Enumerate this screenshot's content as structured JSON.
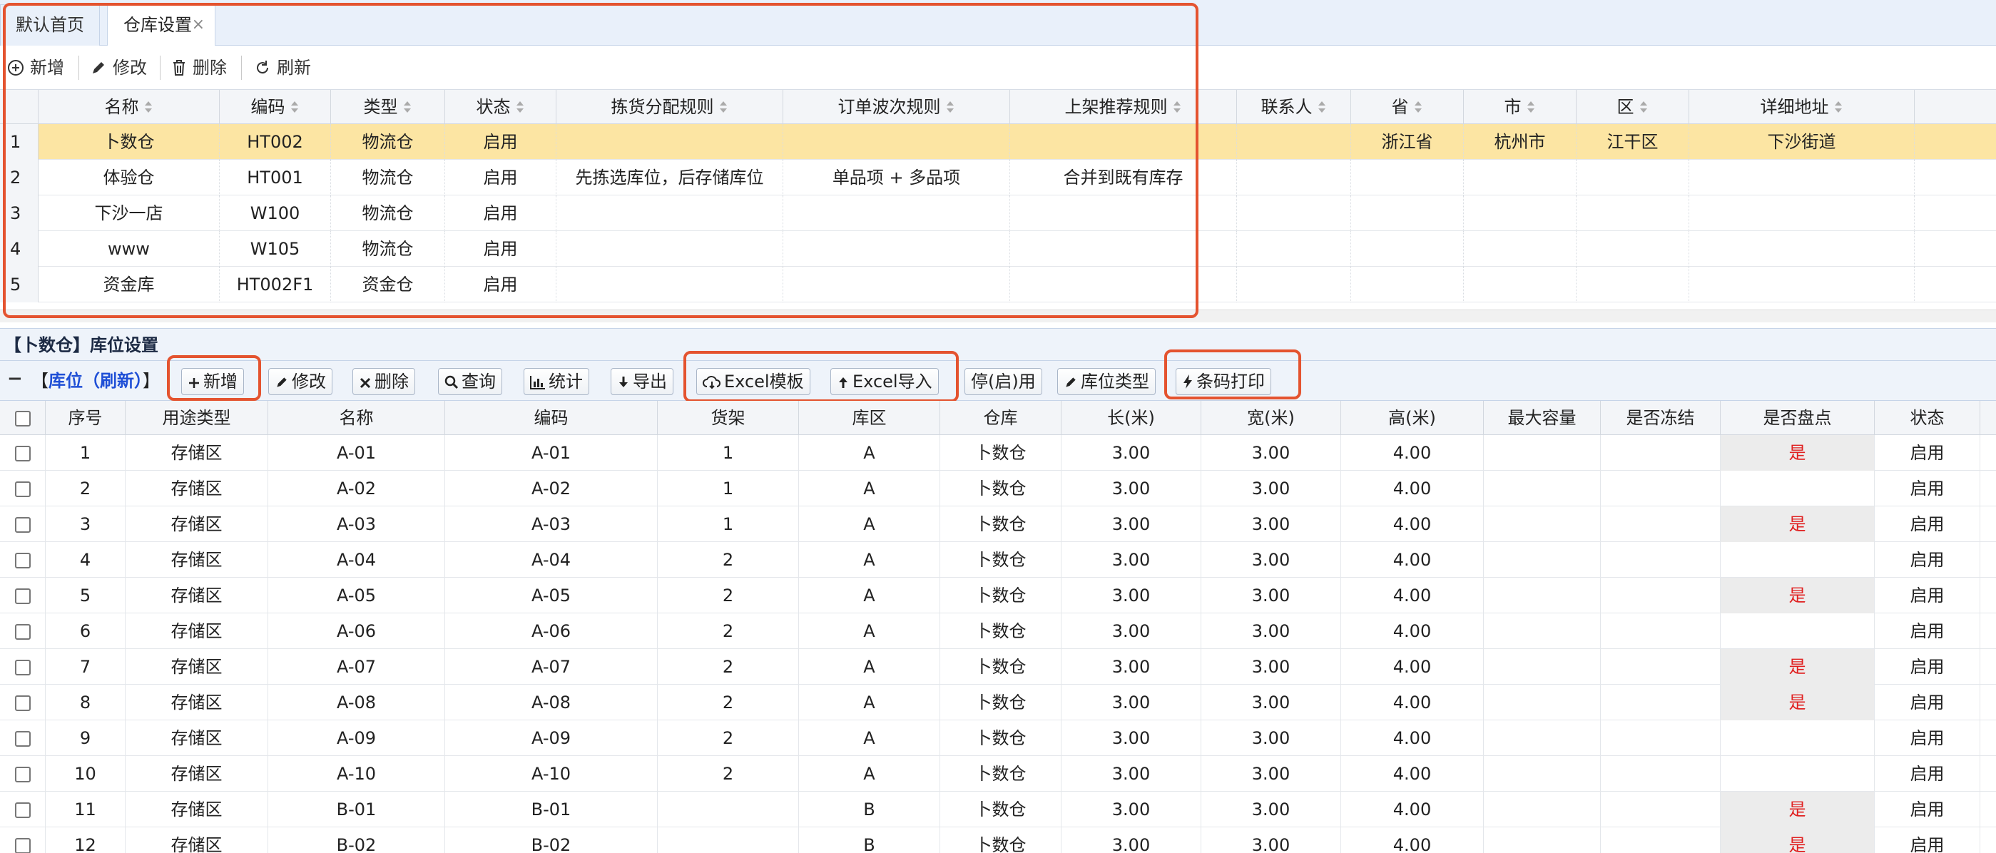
{
  "tabs": [
    {
      "label": "默认首页"
    },
    {
      "label": "仓库设置",
      "close": "×"
    }
  ],
  "toolbar_top": {
    "add": "新增",
    "edit": "修改",
    "delete": "删除",
    "refresh": "刷新"
  },
  "warehouse_grid": {
    "columns": [
      "名称",
      "编码",
      "类型",
      "状态",
      "拣货分配规则",
      "订单波次规则",
      "上架推荐规则",
      "联系人",
      "省",
      "市",
      "区",
      "详细地址"
    ],
    "rows": [
      {
        "num": "1",
        "name": "卜数仓",
        "code": "HT002",
        "type": "物流仓",
        "status": "启用",
        "pick_rule": "",
        "wave_rule": "",
        "putaway_rule": "",
        "contact": "",
        "province": "浙江省",
        "city": "杭州市",
        "district": "江干区",
        "address": "下沙街道",
        "selected": true
      },
      {
        "num": "2",
        "name": "体验仓",
        "code": "HT001",
        "type": "物流仓",
        "status": "启用",
        "pick_rule": "先拣选库位，后存储库位",
        "wave_rule": "单品项 + 多品项",
        "putaway_rule": "合并到既有库存",
        "contact": "",
        "province": "",
        "city": "",
        "district": "",
        "address": ""
      },
      {
        "num": "3",
        "name": "下沙一店",
        "code": "W100",
        "type": "物流仓",
        "status": "启用",
        "pick_rule": "",
        "wave_rule": "",
        "putaway_rule": "",
        "contact": "",
        "province": "",
        "city": "",
        "district": "",
        "address": ""
      },
      {
        "num": "4",
        "name": "www",
        "code": "W105",
        "type": "物流仓",
        "status": "启用",
        "pick_rule": "",
        "wave_rule": "",
        "putaway_rule": "",
        "contact": "",
        "province": "",
        "city": "",
        "district": "",
        "address": ""
      },
      {
        "num": "5",
        "name": "资金库",
        "code": "HT002F1",
        "type": "资金仓",
        "status": "启用",
        "pick_rule": "",
        "wave_rule": "",
        "putaway_rule": "",
        "contact": "",
        "province": "",
        "city": "",
        "district": "",
        "address": ""
      }
    ]
  },
  "location_panel": {
    "title": "【卜数仓】库位设置",
    "collapse": "−",
    "ref_prefix": "【",
    "ref_link": "库位（刷新）",
    "ref_suffix": "】",
    "buttons": {
      "add": "新增",
      "edit": "修改",
      "delete": "删除",
      "query": "查询",
      "stats": "统计",
      "export": "导出",
      "excel_template": "Excel模板",
      "excel_import": "Excel导入",
      "toggle": "停(启)用",
      "location_type": "库位类型",
      "barcode_print": "条码打印"
    }
  },
  "location_grid": {
    "columns": [
      "序号",
      "用途类型",
      "名称",
      "编码",
      "货架",
      "库区",
      "仓库",
      "长(米)",
      "宽(米)",
      "高(米)",
      "最大容量",
      "是否冻结",
      "是否盘点",
      "状态"
    ],
    "rows": [
      {
        "seq": "1",
        "usage": "存储区",
        "name": "A-01",
        "code": "A-01",
        "shelf": "1",
        "zone": "A",
        "warehouse": "卜数仓",
        "length": "3.00",
        "width": "3.00",
        "height": "4.00",
        "capacity": "",
        "frozen": "",
        "counted": "是",
        "status": "启用"
      },
      {
        "seq": "2",
        "usage": "存储区",
        "name": "A-02",
        "code": "A-02",
        "shelf": "1",
        "zone": "A",
        "warehouse": "卜数仓",
        "length": "3.00",
        "width": "3.00",
        "height": "4.00",
        "capacity": "",
        "frozen": "",
        "counted": "",
        "status": "启用"
      },
      {
        "seq": "3",
        "usage": "存储区",
        "name": "A-03",
        "code": "A-03",
        "shelf": "1",
        "zone": "A",
        "warehouse": "卜数仓",
        "length": "3.00",
        "width": "3.00",
        "height": "4.00",
        "capacity": "",
        "frozen": "",
        "counted": "是",
        "status": "启用"
      },
      {
        "seq": "4",
        "usage": "存储区",
        "name": "A-04",
        "code": "A-04",
        "shelf": "2",
        "zone": "A",
        "warehouse": "卜数仓",
        "length": "3.00",
        "width": "3.00",
        "height": "4.00",
        "capacity": "",
        "frozen": "",
        "counted": "",
        "status": "启用"
      },
      {
        "seq": "5",
        "usage": "存储区",
        "name": "A-05",
        "code": "A-05",
        "shelf": "2",
        "zone": "A",
        "warehouse": "卜数仓",
        "length": "3.00",
        "width": "3.00",
        "height": "4.00",
        "capacity": "",
        "frozen": "",
        "counted": "是",
        "status": "启用"
      },
      {
        "seq": "6",
        "usage": "存储区",
        "name": "A-06",
        "code": "A-06",
        "shelf": "2",
        "zone": "A",
        "warehouse": "卜数仓",
        "length": "3.00",
        "width": "3.00",
        "height": "4.00",
        "capacity": "",
        "frozen": "",
        "counted": "",
        "status": "启用"
      },
      {
        "seq": "7",
        "usage": "存储区",
        "name": "A-07",
        "code": "A-07",
        "shelf": "2",
        "zone": "A",
        "warehouse": "卜数仓",
        "length": "3.00",
        "width": "3.00",
        "height": "4.00",
        "capacity": "",
        "frozen": "",
        "counted": "是",
        "status": "启用"
      },
      {
        "seq": "8",
        "usage": "存储区",
        "name": "A-08",
        "code": "A-08",
        "shelf": "2",
        "zone": "A",
        "warehouse": "卜数仓",
        "length": "3.00",
        "width": "3.00",
        "height": "4.00",
        "capacity": "",
        "frozen": "",
        "counted": "是",
        "status": "启用"
      },
      {
        "seq": "9",
        "usage": "存储区",
        "name": "A-09",
        "code": "A-09",
        "shelf": "2",
        "zone": "A",
        "warehouse": "卜数仓",
        "length": "3.00",
        "width": "3.00",
        "height": "4.00",
        "capacity": "",
        "frozen": "",
        "counted": "",
        "status": "启用"
      },
      {
        "seq": "10",
        "usage": "存储区",
        "name": "A-10",
        "code": "A-10",
        "shelf": "2",
        "zone": "A",
        "warehouse": "卜数仓",
        "length": "3.00",
        "width": "3.00",
        "height": "4.00",
        "capacity": "",
        "frozen": "",
        "counted": "",
        "status": "启用"
      },
      {
        "seq": "11",
        "usage": "存储区",
        "name": "B-01",
        "code": "B-01",
        "shelf": "",
        "zone": "B",
        "warehouse": "卜数仓",
        "length": "3.00",
        "width": "3.00",
        "height": "4.00",
        "capacity": "",
        "frozen": "",
        "counted": "是",
        "status": "启用"
      },
      {
        "seq": "12",
        "usage": "存储区",
        "name": "B-02",
        "code": "B-02",
        "shelf": "",
        "zone": "B",
        "warehouse": "卜数仓",
        "length": "3.00",
        "width": "3.00",
        "height": "4.00",
        "capacity": "",
        "frozen": "",
        "counted": "是",
        "status": "启用"
      }
    ]
  },
  "colors": {
    "highlight_box": "#e4532f",
    "selected_row": "#fce5a3",
    "link": "#1f4fd6",
    "yes_flag": "#e02020"
  }
}
